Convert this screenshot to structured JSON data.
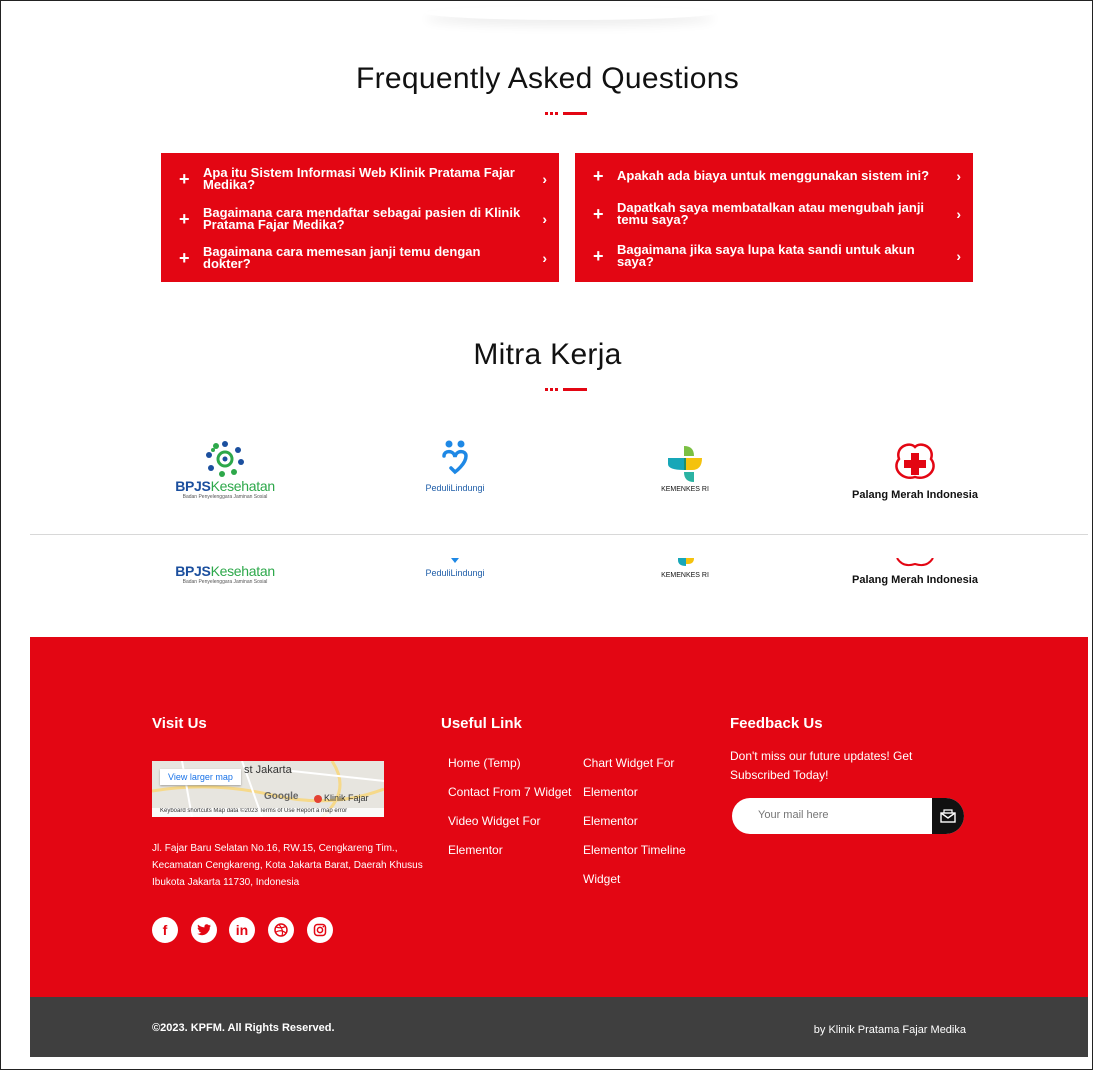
{
  "faq": {
    "title": "Frequently Asked Questions",
    "left": [
      "Apa itu Sistem Informasi Web Klinik Pratama Fajar Medika?",
      "Bagaimana cara mendaftar sebagai pasien di Klinik Pratama Fajar Medika?",
      "Bagaimana cara memesan janji temu dengan dokter?"
    ],
    "right": [
      "Apakah ada biaya untuk menggunakan sistem ini?",
      "Dapatkah saya membatalkan atau mengubah janji temu saya?",
      "Bagaimana jika saya lupa kata sandi untuk akun saya?"
    ]
  },
  "mitra": {
    "title": "Mitra Kerja",
    "logos": {
      "bpjs": "BPJS",
      "bpjs_accent": "Kesehatan",
      "bpjs_sub": "Badan Penyelenggara Jaminan Sosial",
      "peduli": "PeduliLindungi",
      "kemenkes": "KEMENKES RI",
      "pmi": "Palang Merah Indonesia"
    }
  },
  "footer": {
    "visit_title": "Visit Us",
    "map": {
      "view_larger": "View larger map",
      "place": "st Jakarta",
      "google": "Google",
      "marker": "Klinik Fajar",
      "attr": "Keyboard shortcuts   Map data ©2023   Terms of Use   Report a map error"
    },
    "address": "Jl. Fajar Baru Selatan No.16, RW.15, Cengkareng Tim., Kecamatan Cengkareng, Kota Jakarta Barat, Daerah Khusus Ibukota Jakarta 11730, Indonesia",
    "social": [
      "f",
      "t",
      "in",
      "d",
      "ig"
    ],
    "useful_title": "Useful Link",
    "links_col1": [
      "Home (Temp)",
      "Contact From 7 Widget",
      "Video Widget For",
      "Elementor"
    ],
    "links_col2": [
      "Chart Widget For",
      "Elementor",
      "Elementor",
      "Elementor Timeline",
      "Widget"
    ],
    "feedback_title": "Feedback Us",
    "feedback_text": "Don't miss our future updates! Get Subscribed Today!",
    "mail_placeholder": "Your mail here"
  },
  "bottom": {
    "copyright": "©2023. KPFM. All Rights Reserved.",
    "by": "by Klinik Pratama Fajar Medika"
  },
  "colors": {
    "accent": "#e30613",
    "dark": "#3f3f3f"
  }
}
